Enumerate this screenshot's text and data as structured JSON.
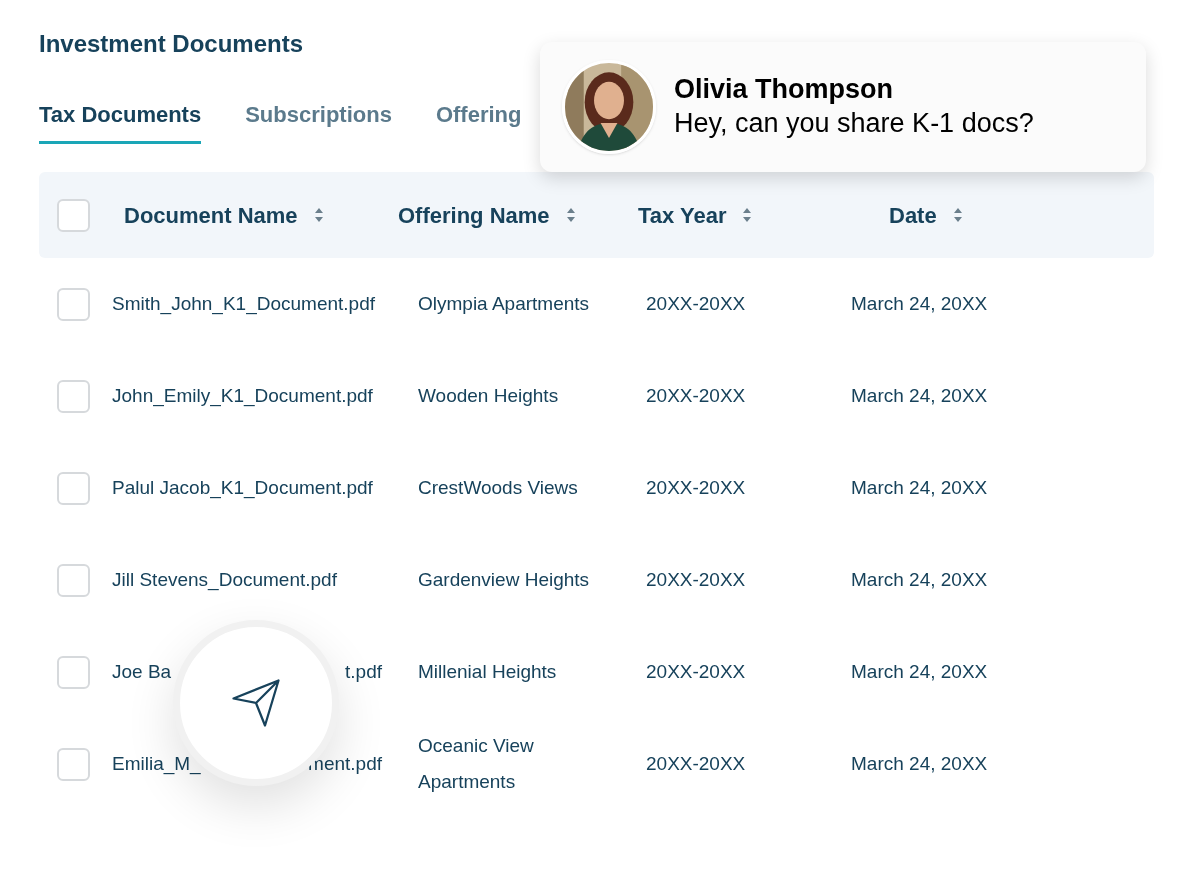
{
  "page_title": "Investment Documents",
  "tabs": [
    {
      "label": "Tax Documents",
      "selected": true
    },
    {
      "label": "Subscriptions",
      "selected": false
    },
    {
      "label": "Offering",
      "selected": false
    }
  ],
  "table": {
    "select_all": {
      "checked": false
    },
    "columns": [
      "Document Name",
      "Offering Name",
      "Tax Year",
      "Date"
    ],
    "rows": [
      {
        "checked": false,
        "document_name": [
          "Smith_John_K1_Document.pdf"
        ],
        "offering_name": [
          "Olympia Apartments"
        ],
        "tax_year": "20XX-20XX",
        "date": "March 24, 20XX"
      },
      {
        "checked": false,
        "document_name": [
          "John_Emily_K1_Document.pdf"
        ],
        "offering_name": [
          "Wooden Heights"
        ],
        "tax_year": "20XX-20XX",
        "date": "March 24, 20XX"
      },
      {
        "checked": false,
        "document_name": [
          "Palul Jacob_K1_Document.pdf"
        ],
        "offering_name": [
          "CrestWoods Views"
        ],
        "tax_year": "20XX-20XX",
        "date": "March 24, 20XX"
      },
      {
        "checked": false,
        "document_name": [
          "Jill Stevens_Document.pdf"
        ],
        "offering_name": [
          "Gardenview Heights"
        ],
        "tax_year": "20XX-20XX",
        "date": "March 24, 20XX"
      },
      {
        "checked": false,
        "document_name": [
          "Joe Ba",
          "t.pdf"
        ],
        "offering_name": [
          "Millenial Heights"
        ],
        "tax_year": "20XX-20XX",
        "date": "March 24, 20XX"
      },
      {
        "checked": false,
        "document_name": [
          "Emilia_M_",
          "ment.pdf"
        ],
        "offering_name": [
          "Oceanic View",
          "Apartments"
        ],
        "tax_year": "20XX-20XX",
        "date": "March 24, 20XX"
      }
    ]
  },
  "notification": {
    "name": "Olivia Thompson",
    "message": "Hey, can you share K-1 docs?"
  }
}
